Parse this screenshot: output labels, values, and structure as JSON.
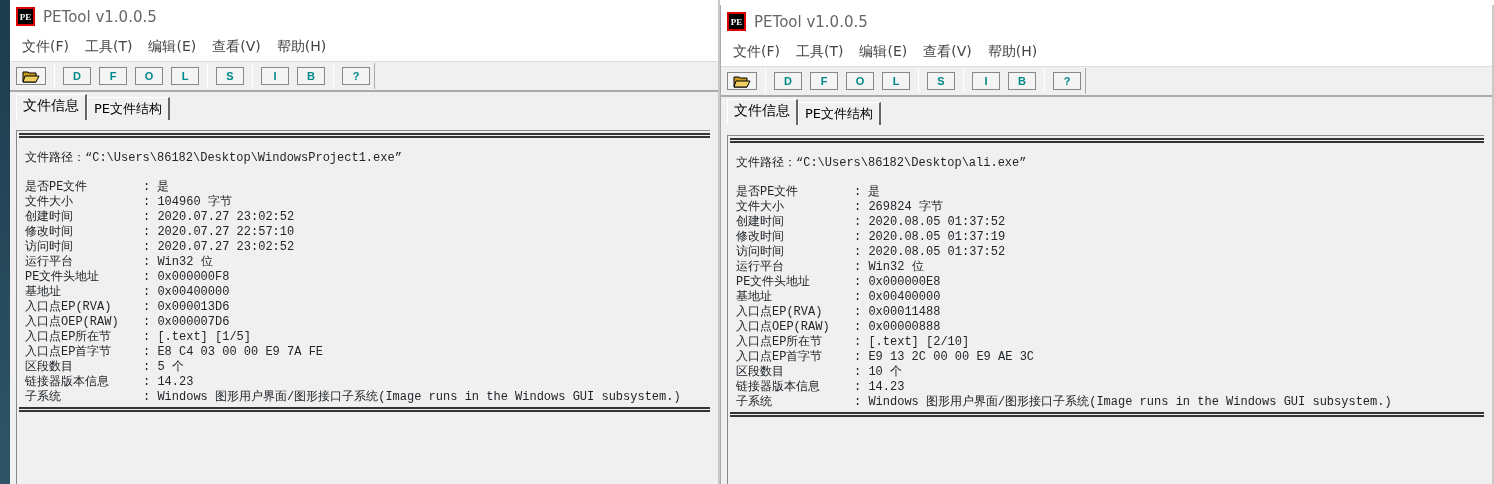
{
  "windows": [
    {
      "title": "PETool v1.0.0.5",
      "logo": "PE",
      "menu": [
        "文件(F)",
        "工具(T)",
        "编辑(E)",
        "查看(V)",
        "帮助(H)"
      ],
      "toolbar": [
        {
          "kind": "icon"
        },
        {
          "kind": "sep"
        },
        {
          "kind": "letter",
          "label": "D"
        },
        {
          "kind": "letter",
          "label": "F"
        },
        {
          "kind": "letter",
          "label": "O"
        },
        {
          "kind": "letter",
          "label": "L"
        },
        {
          "kind": "sep"
        },
        {
          "kind": "letter",
          "label": "S"
        },
        {
          "kind": "sep"
        },
        {
          "kind": "letter",
          "label": "I"
        },
        {
          "kind": "letter",
          "label": "B"
        },
        {
          "kind": "sep"
        },
        {
          "kind": "letter",
          "label": "?"
        }
      ],
      "tabs": [
        {
          "label": "文件信息",
          "selected": true
        },
        {
          "label": "PE文件结构",
          "selected": false
        }
      ],
      "path": "文件路径：“C:\\Users\\86182\\Desktop\\WindowsProject1.exe”",
      "fields": [
        {
          "label": "是否PE文件",
          "value": ": 是"
        },
        {
          "label": "文件大小",
          "value": ": 104960 字节"
        },
        {
          "label": "创建时间",
          "value": ": 2020.07.27 23:02:52"
        },
        {
          "label": "修改时间",
          "value": ": 2020.07.27 22:57:10"
        },
        {
          "label": "访问时间",
          "value": ": 2020.07.27 23:02:52"
        },
        {
          "label": "运行平台",
          "value": ": Win32 位"
        },
        {
          "label": "PE文件头地址",
          "value": ": 0x000000F8"
        },
        {
          "label": "基地址",
          "value": ": 0x00400000"
        },
        {
          "label": "入口点EP(RVA)",
          "value": ": 0x000013D6"
        },
        {
          "label": "入口点OEP(RAW)",
          "value": ": 0x000007D6"
        },
        {
          "label": "入口点EP所在节",
          "value": ": [.text] [1/5]"
        },
        {
          "label": "入口点EP首字节",
          "value": ": E8 C4 03 00 00 E9 7A FE"
        },
        {
          "label": "区段数目",
          "value": ": 5 个"
        },
        {
          "label": "链接器版本信息",
          "value": ": 14.23"
        },
        {
          "label": "子系统",
          "value": ": Windows 图形用户界面/图形接口子系统(Image runs in the Windows GUI subsystem.)"
        }
      ]
    },
    {
      "title": "PETool v1.0.0.5",
      "logo": "PE",
      "menu": [
        "文件(F)",
        "工具(T)",
        "编辑(E)",
        "查看(V)",
        "帮助(H)"
      ],
      "toolbar": [
        {
          "kind": "icon"
        },
        {
          "kind": "sep"
        },
        {
          "kind": "letter",
          "label": "D"
        },
        {
          "kind": "letter",
          "label": "F"
        },
        {
          "kind": "letter",
          "label": "O"
        },
        {
          "kind": "letter",
          "label": "L"
        },
        {
          "kind": "sep"
        },
        {
          "kind": "letter",
          "label": "S"
        },
        {
          "kind": "sep"
        },
        {
          "kind": "letter",
          "label": "I"
        },
        {
          "kind": "letter",
          "label": "B"
        },
        {
          "kind": "sep"
        },
        {
          "kind": "letter",
          "label": "?"
        }
      ],
      "tabs": [
        {
          "label": "文件信息",
          "selected": true
        },
        {
          "label": "PE文件结构",
          "selected": false
        }
      ],
      "path": "文件路径：“C:\\Users\\86182\\Desktop\\ali.exe”",
      "fields": [
        {
          "label": "是否PE文件",
          "value": ": 是"
        },
        {
          "label": "文件大小",
          "value": ": 269824 字节"
        },
        {
          "label": "创建时间",
          "value": ": 2020.08.05 01:37:52"
        },
        {
          "label": "修改时间",
          "value": ": 2020.08.05 01:37:19"
        },
        {
          "label": "访问时间",
          "value": ": 2020.08.05 01:37:52"
        },
        {
          "label": "运行平台",
          "value": ": Win32 位"
        },
        {
          "label": "PE文件头地址",
          "value": ": 0x000000E8"
        },
        {
          "label": "基地址",
          "value": ": 0x00400000"
        },
        {
          "label": "入口点EP(RVA)",
          "value": ": 0x00011488"
        },
        {
          "label": "入口点OEP(RAW)",
          "value": ": 0x00000888"
        },
        {
          "label": "入口点EP所在节",
          "value": ": [.text] [2/10]"
        },
        {
          "label": "入口点EP首字节",
          "value": ": E9 13 2C 00 00 E9 AE 3C"
        },
        {
          "label": "区段数目",
          "value": ": 10 个"
        },
        {
          "label": "链接器版本信息",
          "value": ": 14.23"
        },
        {
          "label": "子系统",
          "value": ": Windows 图形用户界面/图形接口子系统(Image runs in the Windows GUI subsystem.)"
        }
      ]
    }
  ]
}
